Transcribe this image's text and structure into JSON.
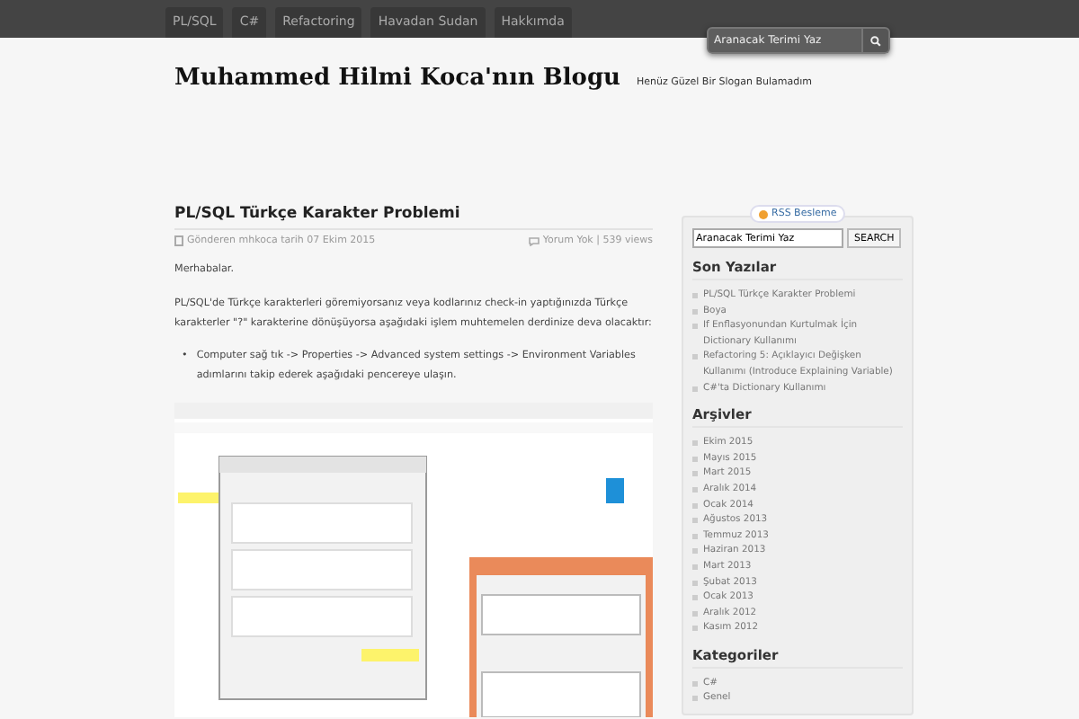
{
  "nav": {
    "items": [
      "PL/SQL",
      "C#",
      "Refactoring",
      "Havadan Sudan",
      "Hakkımda"
    ]
  },
  "top_search": {
    "placeholder": "Aranacak Terimi Yaz"
  },
  "header": {
    "title": "Muhammed Hilmi Koca'nın Blogu",
    "slogan": "Henüz Güzel Bir Slogan Bulamadım"
  },
  "post": {
    "title": "PL/SQL Türkçe Karakter Problemi",
    "byline": "Gönderen mhkoca tarih 07 Ekim 2015",
    "comments": "Yorum Yok | 539 views",
    "paragraphs": [
      "Merhabalar.",
      "PL/SQL'de Türkçe karakterleri göremiyorsanız veya kodlarınız check-in yaptığınızda Türkçe karakterler \"?\" karakterine dönüşüyorsa aşağıdaki işlem muhtemelen derdinize deva olacaktır:"
    ],
    "bullet_marker": "•",
    "bullets": [
      "Computer sağ tık -> Properties -> Advanced system settings -> Environment Variables adımlarını takip ederek aşağıdaki pencereye ulaşın."
    ],
    "image": {
      "kind": "picture"
    }
  },
  "sidebar": {
    "rss": "RSS Besleme",
    "search": {
      "value": "Aranacak Terimi Yaz",
      "button": "SEARCH"
    },
    "sections": [
      {
        "heading": "Son Yazılar",
        "items": [
          "PL/SQL Türkçe Karakter Problemi",
          "Boya",
          "If Enflasyonundan Kurtulmak İçin Dictionary Kullanımı",
          "Refactoring 5: Açıklayıcı Değişken Kullanımı (Introduce Explaining Variable)",
          "C#'ta Dictionary Kullanımı"
        ]
      },
      {
        "heading": "Arşivler",
        "items": [
          "Ekim 2015",
          "Mayıs 2015",
          "Mart 2015",
          "Aralık 2014",
          "Ocak 2014",
          "Ağustos 2013",
          "Temmuz 2013",
          "Haziran 2013",
          "Mart 2013",
          "Şubat 2013",
          "Ocak 2013",
          "Aralık 2012",
          "Kasım 2012"
        ]
      },
      {
        "heading": "Kategoriler",
        "items": [
          "C#",
          "Genel"
        ]
      }
    ]
  }
}
